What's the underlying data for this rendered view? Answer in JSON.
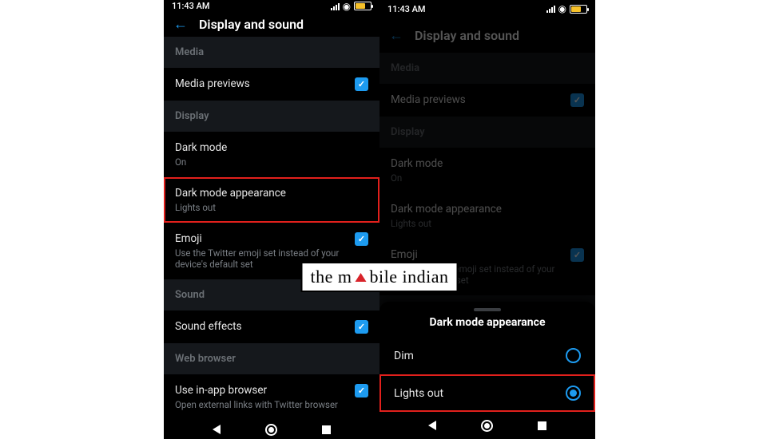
{
  "status": {
    "time": "11:43 AM"
  },
  "screen_title": "Display and sound",
  "sections": {
    "media": {
      "header": "Media",
      "previews_label": "Media previews"
    },
    "display": {
      "header": "Display",
      "dark_mode_label": "Dark mode",
      "dark_mode_value": "On",
      "appearance_label": "Dark mode appearance",
      "appearance_value": "Lights out",
      "emoji_label": "Emoji",
      "emoji_sub": "Use the Twitter emoji set instead of your device's default set"
    },
    "sound": {
      "header": "Sound",
      "effects_label": "Sound effects"
    },
    "web": {
      "header": "Web browser",
      "inapp_label": "Use in-app browser",
      "inapp_sub": "Open external links with Twitter browser"
    }
  },
  "sheet": {
    "title": "Dark mode appearance",
    "options": {
      "dim": "Dim",
      "lights_out": "Lights out"
    }
  },
  "logo": {
    "pre": "the m",
    "post": "bile indian"
  }
}
